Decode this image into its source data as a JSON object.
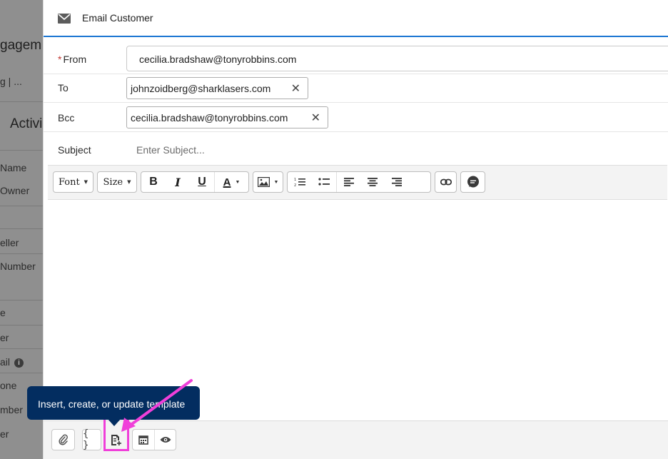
{
  "background": {
    "labels": [
      "gagem",
      "g | ...",
      "Activi",
      "Name",
      "Owner",
      "eller",
      "Number",
      "e",
      "er",
      "ail",
      "one",
      "mber",
      "er"
    ]
  },
  "modal": {
    "title": "Email Customer",
    "header_icon": "envelope-icon"
  },
  "fields": {
    "from": {
      "label": "From",
      "required_mark": "*",
      "value": "cecilia.bradshaw@tonyrobbins.com"
    },
    "to": {
      "label": "To",
      "pills": [
        "johnzoidberg@sharklasers.com"
      ]
    },
    "bcc": {
      "label": "Bcc",
      "pills": [
        "cecilia.bradshaw@tonyrobbins.com"
      ]
    },
    "subject": {
      "label": "Subject",
      "placeholder": "Enter Subject..."
    }
  },
  "rte_toolbar": {
    "font_label": "Font",
    "size_label": "Size",
    "bold": "B",
    "italic": "I",
    "underline": "U",
    "color": "A",
    "icons": [
      "image-icon",
      "numbered-list-icon",
      "bulleted-list-icon",
      "align-left-icon",
      "align-center-icon",
      "align-right-icon",
      "link-icon",
      "comment-icon"
    ]
  },
  "bottom_toolbar": {
    "merge_field_label": "{ }",
    "icons": [
      "paperclip-icon",
      "merge-field-icon",
      "template-icon",
      "calendar-icon",
      "eye-icon"
    ]
  },
  "tooltip": {
    "text": "Insert, create, or update template"
  },
  "colors": {
    "accent": "#1b76d2",
    "tooltip_bg": "#032d60",
    "highlight": "#f03fd9",
    "required": "#c23934"
  }
}
